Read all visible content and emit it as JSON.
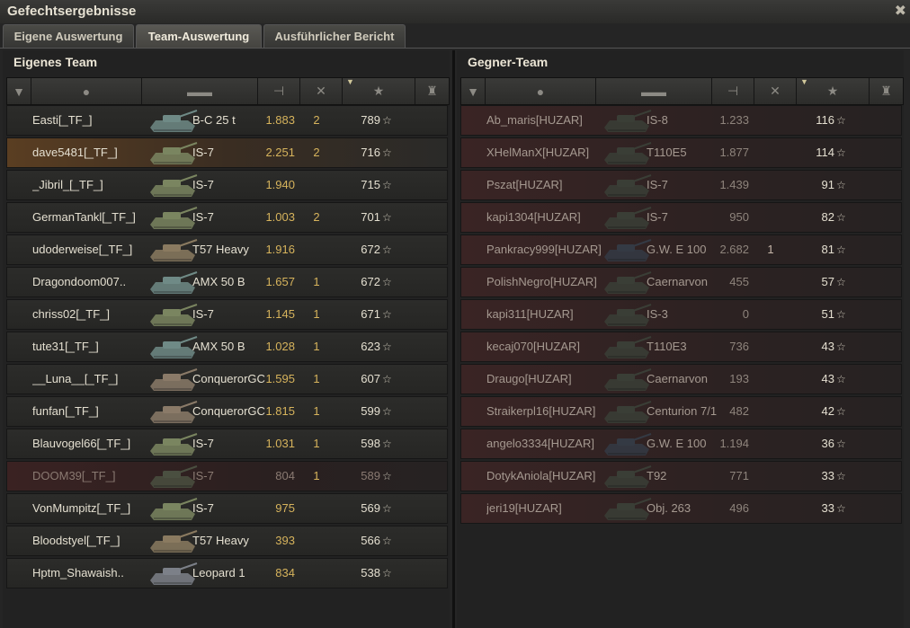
{
  "window": {
    "title": "Gefechtsergebnisse"
  },
  "tabs": [
    {
      "label": "Eigene Auswertung",
      "active": false
    },
    {
      "label": "Team-Auswertung",
      "active": true
    },
    {
      "label": "Ausführlicher Bericht",
      "active": false
    }
  ],
  "colors": {
    "damage": "#d6b35c",
    "highlight": "#5a3e22",
    "enemy_row": "#3a2424"
  },
  "own_team": {
    "title": "Eigenes Team",
    "rows": [
      {
        "name": "Easti[_TF_]",
        "tank": "B-C 25 t",
        "damage": "1.883",
        "kills": "2",
        "xp": "789",
        "tank_color": "#6f8a86",
        "state": "normal"
      },
      {
        "name": "dave5481[_TF_]",
        "tank": "IS-7",
        "damage": "2.251",
        "kills": "2",
        "xp": "716",
        "tank_color": "#7a8560",
        "state": "highlight"
      },
      {
        "name": "_Jibril_[_TF_]",
        "tank": "IS-7",
        "damage": "1.940",
        "kills": "",
        "xp": "715",
        "tank_color": "#7a8560",
        "state": "normal"
      },
      {
        "name": "GermanTankl[_TF_]",
        "tank": "IS-7",
        "damage": "1.003",
        "kills": "2",
        "xp": "701",
        "tank_color": "#7a8560",
        "state": "normal"
      },
      {
        "name": "udoderweise[_TF_]",
        "tank": "T57 Heavy",
        "damage": "1.916",
        "kills": "",
        "xp": "672",
        "tank_color": "#8a7a60",
        "state": "normal"
      },
      {
        "name": "Dragondoom007..",
        "tank": "AMX 50 B",
        "damage": "1.657",
        "kills": "1",
        "xp": "672",
        "tank_color": "#6f8a86",
        "state": "normal"
      },
      {
        "name": "chriss02[_TF_]",
        "tank": "IS-7",
        "damage": "1.145",
        "kills": "1",
        "xp": "671",
        "tank_color": "#7a8560",
        "state": "normal"
      },
      {
        "name": "tute31[_TF_]",
        "tank": "AMX 50 B",
        "damage": "1.028",
        "kills": "1",
        "xp": "623",
        "tank_color": "#6f8a86",
        "state": "normal"
      },
      {
        "name": "__Luna__[_TF_]",
        "tank": "ConquerorGC",
        "damage": "1.595",
        "kills": "1",
        "xp": "607",
        "tank_color": "#8a7a68",
        "state": "normal"
      },
      {
        "name": "funfan[_TF_]",
        "tank": "ConquerorGC",
        "damage": "1.815",
        "kills": "1",
        "xp": "599",
        "tank_color": "#8a7a68",
        "state": "normal"
      },
      {
        "name": "Blauvogel66[_TF_]",
        "tank": "IS-7",
        "damage": "1.031",
        "kills": "1",
        "xp": "598",
        "tank_color": "#7a8560",
        "state": "normal"
      },
      {
        "name": "DOOM39[_TF_]",
        "tank": "IS-7",
        "damage": "804",
        "kills": "1",
        "xp": "589",
        "tank_color": "#4a4f40",
        "state": "dead"
      },
      {
        "name": "VonMumpitz[_TF_]",
        "tank": "IS-7",
        "damage": "975",
        "kills": "",
        "xp": "569",
        "tank_color": "#7a8560",
        "state": "normal"
      },
      {
        "name": "Bloodstyel[_TF_]",
        "tank": "T57 Heavy",
        "damage": "393",
        "kills": "",
        "xp": "566",
        "tank_color": "#8a7a60",
        "state": "normal"
      },
      {
        "name": "Hptm_Shawaish..",
        "tank": "Leopard 1",
        "damage": "834",
        "kills": "",
        "xp": "538",
        "tank_color": "#7c8088",
        "state": "normal"
      }
    ]
  },
  "enemy_team": {
    "title": "Gegner-Team",
    "rows": [
      {
        "name": "Ab_maris[HUZAR]",
        "tank": "IS-8",
        "damage": "1.233",
        "kills": "",
        "xp": "116",
        "tank_color": "#3a3e36",
        "state": "enemy"
      },
      {
        "name": "XHelManX[HUZAR]",
        "tank": "T110E5",
        "damage": "1.877",
        "kills": "",
        "xp": "114",
        "tank_color": "#3a3e36",
        "state": "enemy"
      },
      {
        "name": "Pszat[HUZAR]",
        "tank": "IS-7",
        "damage": "1.439",
        "kills": "",
        "xp": "91",
        "tank_color": "#3a3e36",
        "state": "enemy"
      },
      {
        "name": "kapi1304[HUZAR]",
        "tank": "IS-7",
        "damage": "950",
        "kills": "",
        "xp": "82",
        "tank_color": "#3a3e36",
        "state": "enemy"
      },
      {
        "name": "Pankracy999[HUZAR]",
        "tank": "G.W. E 100",
        "damage": "2.682",
        "kills": "1",
        "xp": "81",
        "tank_color": "#343a44",
        "state": "enemy"
      },
      {
        "name": "PolishNegro[HUZAR]",
        "tank": "Caernarvon",
        "damage": "455",
        "kills": "",
        "xp": "57",
        "tank_color": "#3a3e36",
        "state": "enemy"
      },
      {
        "name": "kapi311[HUZAR]",
        "tank": "IS-3",
        "damage": "0",
        "kills": "",
        "xp": "51",
        "tank_color": "#3a3e36",
        "state": "enemy"
      },
      {
        "name": "kecaj070[HUZAR]",
        "tank": "T110E3",
        "damage": "736",
        "kills": "",
        "xp": "43",
        "tank_color": "#3a3e36",
        "state": "enemy"
      },
      {
        "name": "Draugo[HUZAR]",
        "tank": "Caernarvon",
        "damage": "193",
        "kills": "",
        "xp": "43",
        "tank_color": "#3a3e36",
        "state": "enemy"
      },
      {
        "name": "Straikerpl16[HUZAR]",
        "tank": "Centurion 7/1",
        "damage": "482",
        "kills": "",
        "xp": "42",
        "tank_color": "#3a3e36",
        "state": "enemy"
      },
      {
        "name": "angelo3334[HUZAR]",
        "tank": "G.W. E 100",
        "damage": "1.194",
        "kills": "",
        "xp": "36",
        "tank_color": "#343a44",
        "state": "enemy"
      },
      {
        "name": "DotykAniola[HUZAR]",
        "tank": "T92",
        "damage": "771",
        "kills": "",
        "xp": "33",
        "tank_color": "#3a3e36",
        "state": "enemy"
      },
      {
        "name": "jeri19[HUZAR]",
        "tank": "Obj. 263",
        "damage": "496",
        "kills": "",
        "xp": "33",
        "tank_color": "#3a3e36",
        "state": "enemy"
      }
    ]
  },
  "star_glyph": "☆"
}
